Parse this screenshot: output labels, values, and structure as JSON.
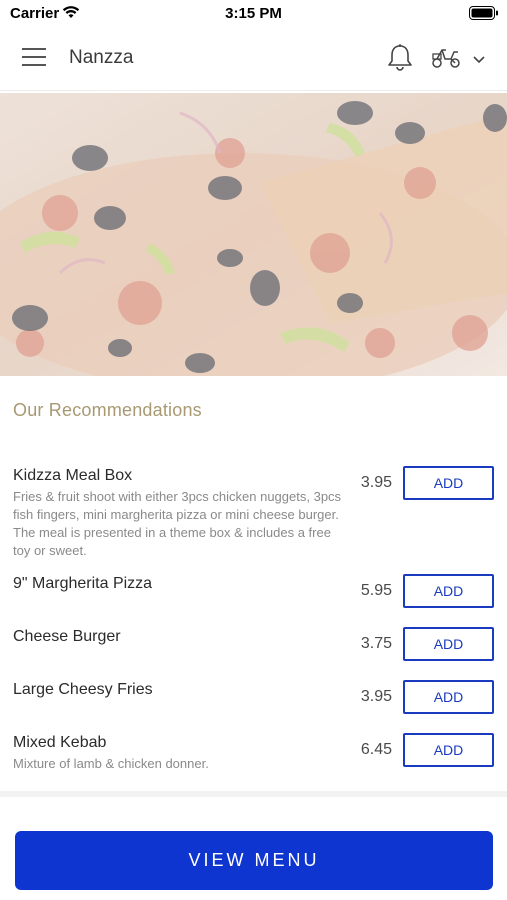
{
  "status_bar": {
    "carrier": "Carrier",
    "time": "3:15 PM"
  },
  "header": {
    "title": "Nanzza"
  },
  "icons": {
    "menu": "hamburger-menu-icon",
    "notifications": "bell-icon",
    "delivery": "scooter-icon",
    "dropdown": "chevron-down-icon"
  },
  "recommendations": {
    "title": "Our Recommendations",
    "items": [
      {
        "name": "Kidzza Meal Box",
        "description": "Fries & fruit shoot with either 3pcs chicken nuggets, 3pcs fish fingers, mini margherita pizza or mini cheese burger. The meal is presented in a theme box & includes a free toy or sweet.",
        "price": "3.95",
        "button": "ADD"
      },
      {
        "name": "9\" Margherita Pizza",
        "description": "",
        "price": "5.95",
        "button": "ADD"
      },
      {
        "name": "Cheese Burger",
        "description": "",
        "price": "3.75",
        "button": "ADD"
      },
      {
        "name": "Large Cheesy Fries",
        "description": "",
        "price": "3.95",
        "button": "ADD"
      },
      {
        "name": "Mixed Kebab",
        "description": "Mixture of lamb & chicken donner.",
        "price": "6.45",
        "button": "ADD"
      }
    ]
  },
  "footer": {
    "view_menu": "VIEW MENU"
  },
  "colors": {
    "accent": "#0f35d0",
    "section_title": "#a89972",
    "add_border": "#1a3bbf"
  }
}
